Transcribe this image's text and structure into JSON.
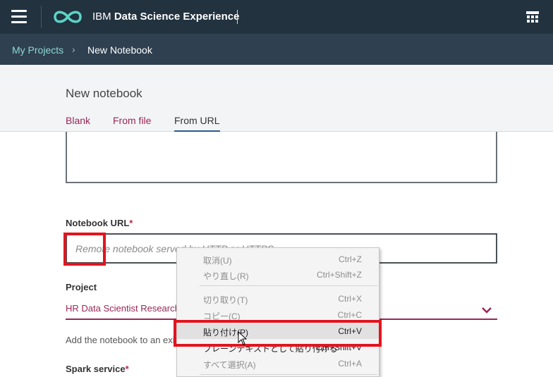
{
  "app": {
    "brand_prefix": "IBM ",
    "brand_bold": "Data Science Experience"
  },
  "breadcrumb": {
    "parent": "My Projects",
    "separator": "›",
    "current": "New Notebook"
  },
  "page": {
    "title": "New notebook",
    "tabs": [
      {
        "label": "Blank",
        "active": false
      },
      {
        "label": "From file",
        "active": false
      },
      {
        "label": "From URL",
        "active": true
      }
    ]
  },
  "form": {
    "url_label": "Notebook URL",
    "required_mark": "*",
    "url_placeholder": "Remote notebook served by HTTP or HTTPS",
    "project_label": "Project",
    "project_value": "HR Data Scientist Research",
    "project_helper": "Add the notebook to an existing project",
    "spark_label": "Spark service",
    "spark_required": "*"
  },
  "context_menu": {
    "items": [
      {
        "label": "取消(U)",
        "shortcut": "Ctrl+Z",
        "enabled": false
      },
      {
        "label": "やり直し(R)",
        "shortcut": "Ctrl+Shift+Z",
        "enabled": false
      },
      {
        "label": "切り取り(T)",
        "shortcut": "Ctrl+X",
        "enabled": false
      },
      {
        "label": "コピー(C)",
        "shortcut": "Ctrl+C",
        "enabled": false
      },
      {
        "label": "貼り付け(P)",
        "shortcut": "Ctrl+V",
        "enabled": true,
        "hovered": true
      },
      {
        "label": "プレーンテキストとして貼り付ける",
        "shortcut": "Ctrl+Shift+V",
        "enabled": true
      },
      {
        "label": "すべて選択(A)",
        "shortcut": "Ctrl+A",
        "enabled": false
      }
    ]
  },
  "colors": {
    "topbar": "#22323f",
    "crumbbar": "#2f4050",
    "accent_link": "#9a2659",
    "crumb_link": "#8fd8d3",
    "highlight": "#e3141e"
  },
  "icons": [
    "hamburger-menu-icon",
    "infinity-logo-icon",
    "apps-grid-icon",
    "chevron-down-icon",
    "mouse-pointer-icon"
  ]
}
